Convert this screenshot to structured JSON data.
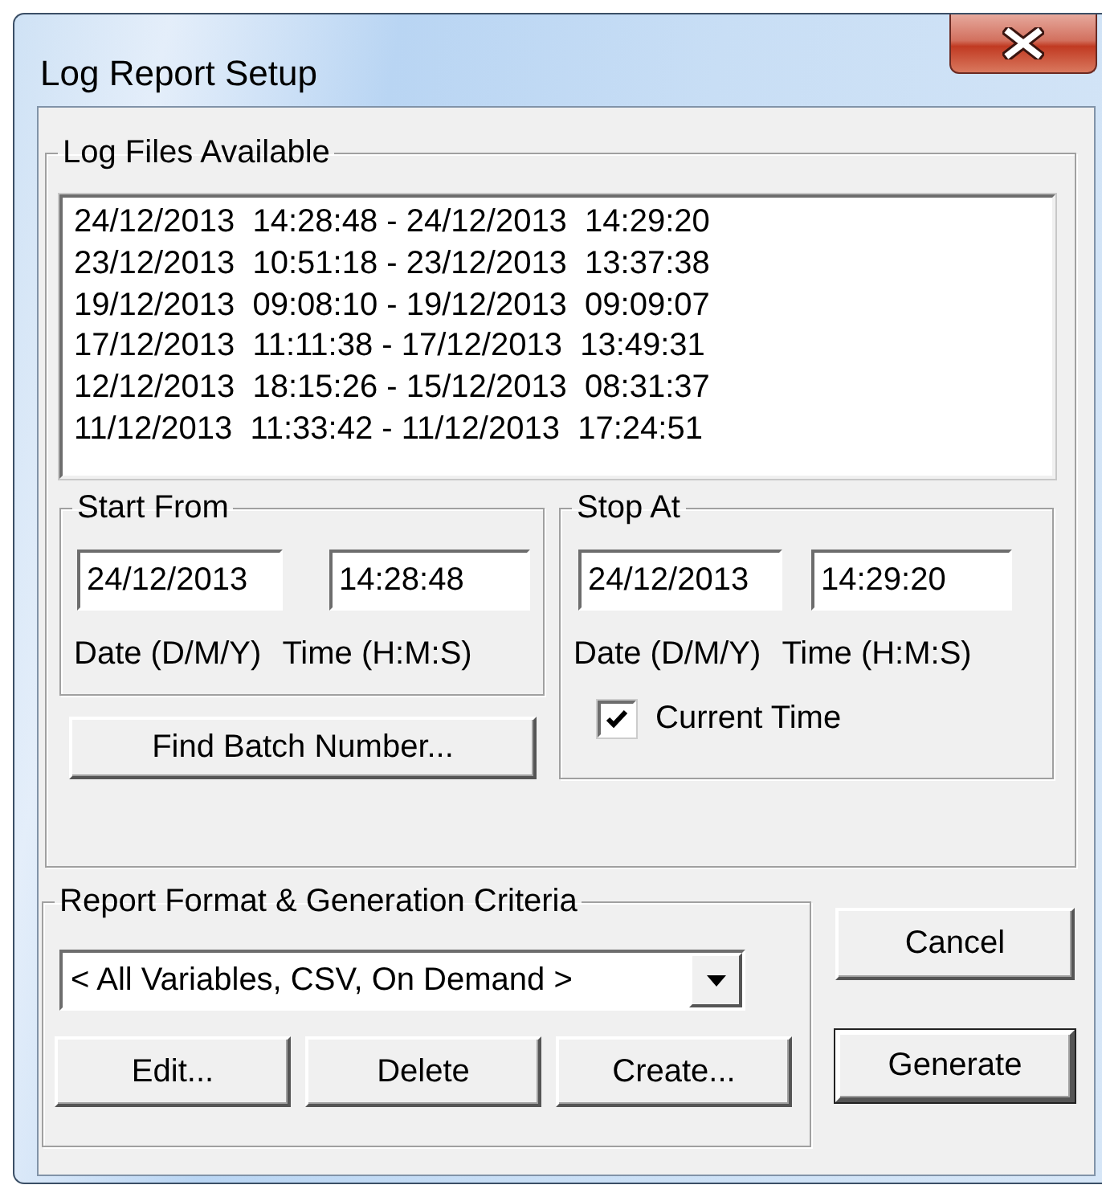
{
  "window": {
    "title": "Log Report Setup"
  },
  "log_files": {
    "label": "Log Files Available",
    "items": [
      {
        "text": "24/12/2013  14:28:48 - 24/12/2013  14:29:20"
      },
      {
        "text": "23/12/2013  10:51:18 - 23/12/2013  13:37:38"
      },
      {
        "text": "19/12/2013  09:08:10 - 19/12/2013  09:09:07"
      },
      {
        "text": "17/12/2013  11:11:38 - 17/12/2013  13:49:31"
      },
      {
        "text": "12/12/2013  18:15:26 - 15/12/2013  08:31:37"
      },
      {
        "text": "11/12/2013  11:33:42 - 11/12/2013  17:24:51"
      }
    ]
  },
  "start_from": {
    "label": "Start From",
    "date": "24/12/2013",
    "time": "14:28:48",
    "date_hint": "Date (D/M/Y)",
    "time_hint": "Time (H:M:S)"
  },
  "find_batch_button": "Find Batch Number...",
  "stop_at": {
    "label": "Stop At",
    "date": "24/12/2013",
    "time": "14:29:20",
    "date_hint": "Date (D/M/Y)",
    "time_hint": "Time (H:M:S)",
    "current_time": {
      "label": "Current Time",
      "checked": true
    }
  },
  "report_format": {
    "label": "Report Format & Generation Criteria",
    "selection": "< All Variables, CSV, On Demand >",
    "buttons": [
      "Edit...",
      "Delete",
      "Create..."
    ]
  },
  "buttons": [
    {
      "label": "Cancel",
      "default": false
    },
    {
      "label": "Generate",
      "default": true
    }
  ]
}
